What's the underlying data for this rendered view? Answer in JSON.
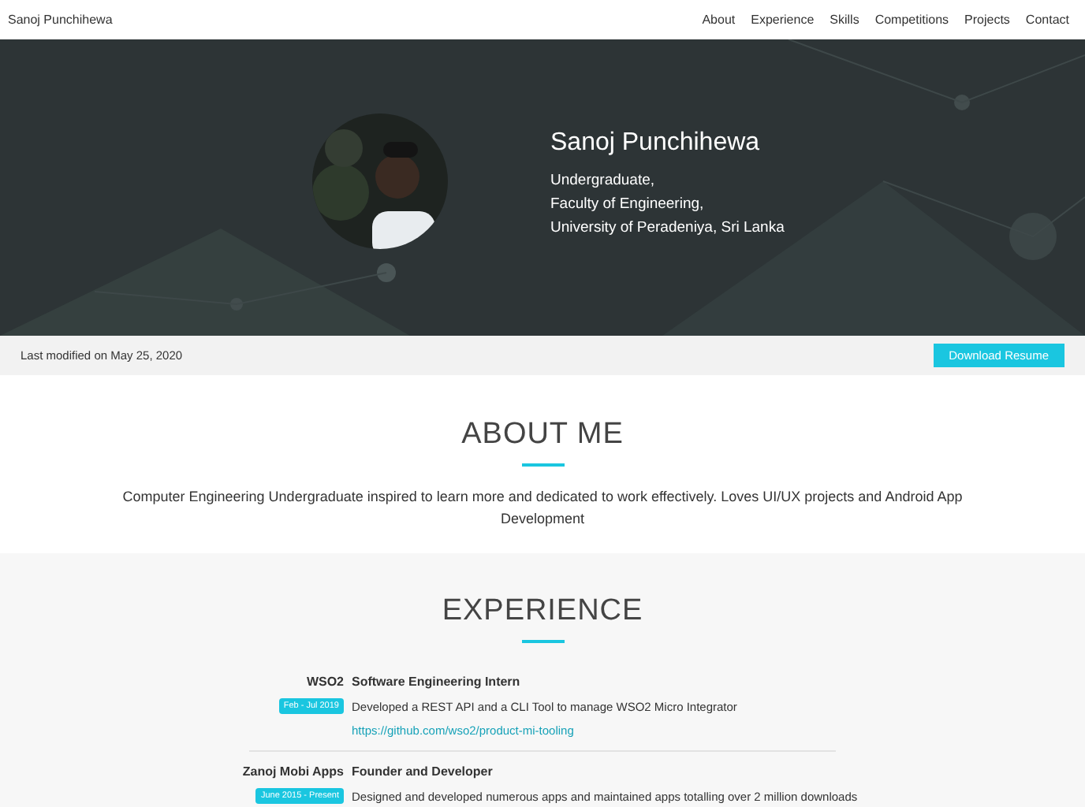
{
  "navbar": {
    "brand": "Sanoj Punchihewa",
    "links": [
      "About",
      "Experience",
      "Skills",
      "Competitions",
      "Projects",
      "Contact"
    ]
  },
  "hero": {
    "name": "Sanoj Punchihewa",
    "lines": [
      "Undergraduate,",
      "Faculty of Engineering,",
      "University of Peradeniya, Sri Lanka"
    ]
  },
  "info_bar": {
    "modified": "Last modified on May 25, 2020",
    "button": "Download Resume"
  },
  "about": {
    "heading": "ABOUT ME",
    "text": "Computer Engineering Undergraduate inspired to learn more and dedicated to work effectively. Loves UI/UX projects and Android App Development"
  },
  "experience": {
    "heading": "EXPERIENCE",
    "items": [
      {
        "company": "WSO2",
        "dates": "Feb - Jul 2019",
        "role": "Software Engineering Intern",
        "description": "Developed a REST API and a CLI Tool to manage WSO2 Micro Integrator",
        "link": "https://github.com/wso2/product-mi-tooling"
      },
      {
        "company": "Zanoj Mobi Apps",
        "dates": "June 2015 - Present",
        "role": "Founder and Developer",
        "description": "Designed and developed numerous apps and maintained apps totalling over 2 million downloads"
      }
    ]
  }
}
